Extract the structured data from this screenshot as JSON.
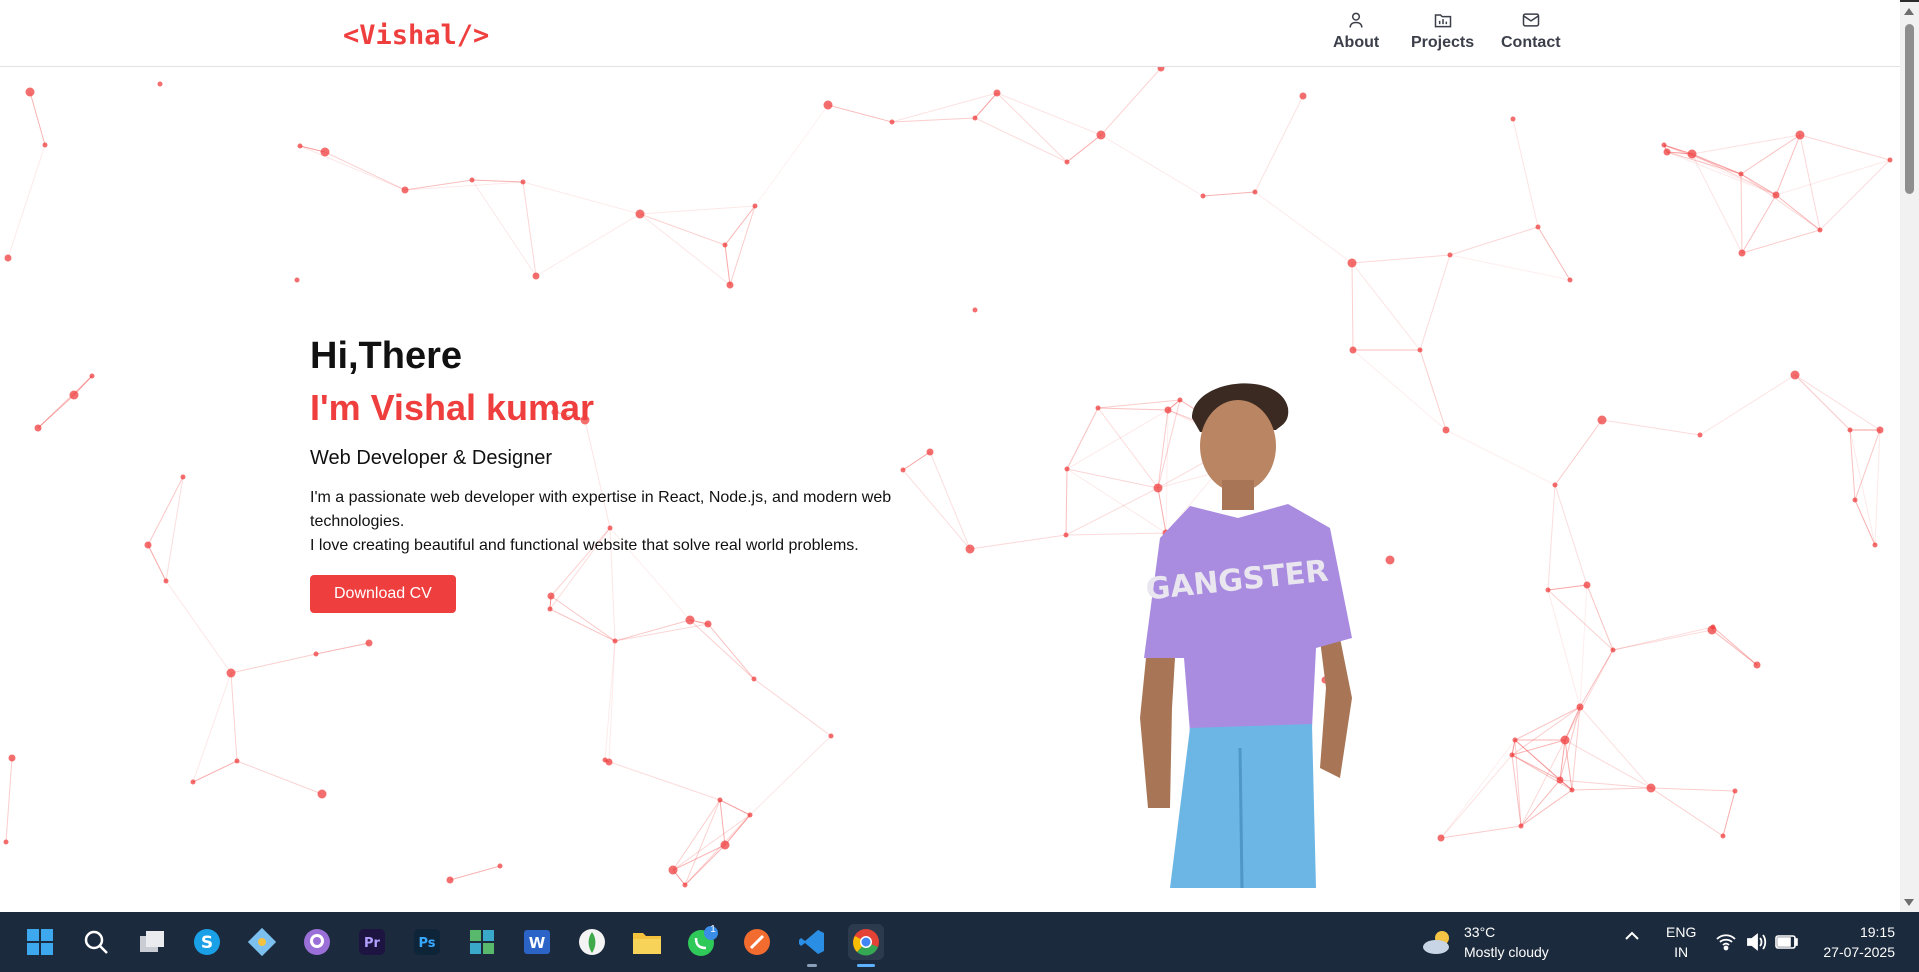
{
  "brand": {
    "logo": "<Vishal/>",
    "accent": "#ef3e3e"
  },
  "nav": [
    {
      "label": "About",
      "icon": "user-icon"
    },
    {
      "label": "Projects",
      "icon": "folder-icon"
    },
    {
      "label": "Contact",
      "icon": "mail-icon"
    }
  ],
  "hero": {
    "greeting": "Hi,There",
    "name": "I'm Vishal kumar",
    "role": "Web Developer & Designer",
    "desc_line1": "I'm a passionate web developer with expertise in React, Node.js, and modern web technologies.",
    "desc_line2": "I love creating beautiful and functional website that solve real world problems.",
    "cta": "Download CV",
    "portrait": "profile-photo"
  },
  "taskbar": {
    "apps": [
      "start-icon",
      "search-icon",
      "task-view-icon",
      "skype-icon",
      "git-icon",
      "github-icon",
      "premiere-icon",
      "photoshop-icon",
      "widgets-icon",
      "word-icon",
      "mongodb-icon",
      "file-explorer-icon",
      "whatsapp-icon",
      "postman-icon",
      "vscode-icon",
      "chrome-icon"
    ],
    "whatsapp_badge": "1",
    "weather_temp": "33°C",
    "weather_desc": "Mostly cloudy",
    "lang_line1": "ENG",
    "lang_line2": "IN",
    "time": "19:15",
    "date": "27-07-2025"
  }
}
